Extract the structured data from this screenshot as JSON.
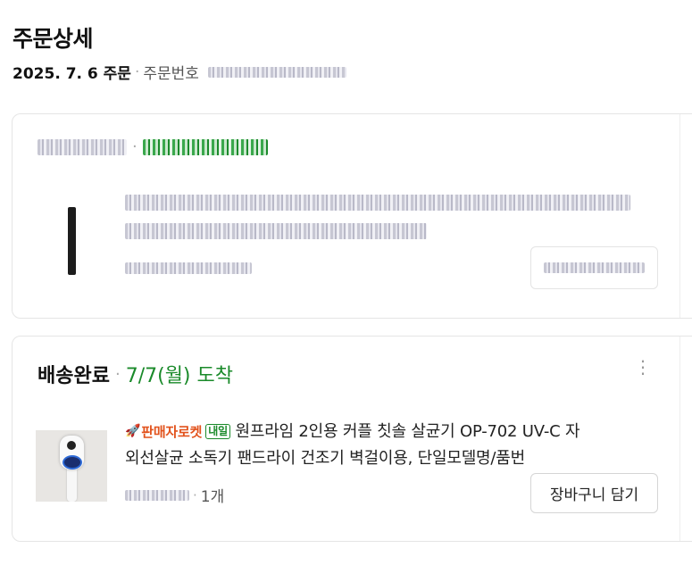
{
  "page": {
    "title": "주문상세",
    "order_date": "2025. 7. 6 주문",
    "order_no_label": "주문번호",
    "separator": "·"
  },
  "orders": [
    {
      "status": "배송완료",
      "arrival": "7/7(월) 도착",
      "product_title": "",
      "price_qty": "",
      "cart_button": "장바구니 담기",
      "blurred": true
    },
    {
      "status": "배송완료",
      "arrival": "7/7(월) 도착",
      "rocket_label": "판매자로켓",
      "next_day_badge": "내일",
      "product_title_line1": "원프라임 2인용 커플 칫솔 살균기 OP-702 UV-C 자",
      "product_title_line2": "외선살균 소독기 팬드라이 건조기 벽걸이용, 단일모델명/품번",
      "quantity": "1개",
      "cart_button": "장바구니 담기",
      "more_icon": "more-vertical-icon",
      "blurred": false
    }
  ],
  "colors": {
    "arrival_green": "#1a8a2a",
    "rocket_orange": "#e2531d"
  }
}
